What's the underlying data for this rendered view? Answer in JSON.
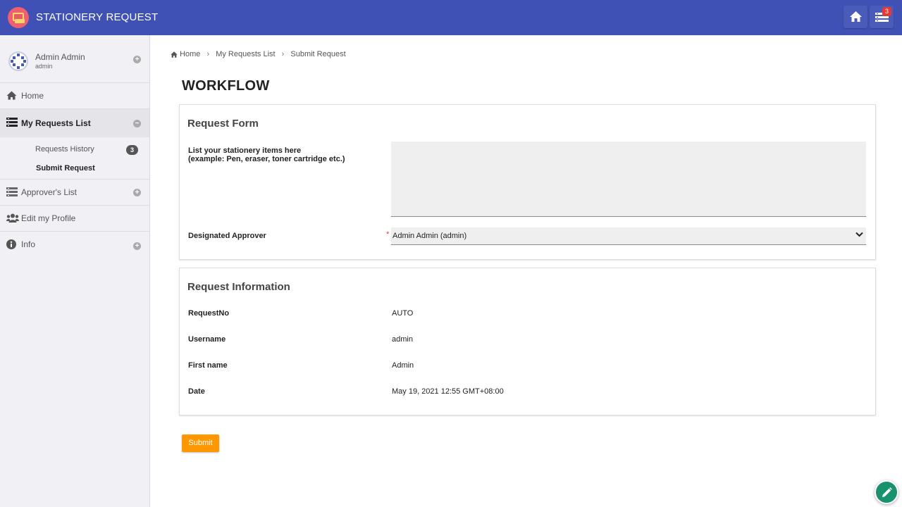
{
  "app": {
    "title": "STATIONERY REQUEST",
    "notification_count": "3"
  },
  "user": {
    "name": "Admin Admin",
    "login": "admin"
  },
  "sidebar": {
    "home": "Home",
    "my_requests": "My Requests List",
    "sub_items": [
      {
        "label": "Requests History",
        "badge": "3"
      },
      {
        "label": "Submit Request"
      }
    ],
    "approvers": "Approver's List",
    "profile": "Edit my Profile",
    "info": "Info"
  },
  "breadcrumb": [
    "Home",
    "My Requests List",
    "Submit Request"
  ],
  "page_title": "WORKFLOW",
  "request_form": {
    "heading": "Request Form",
    "items_label_line1": "List your stationery items here",
    "items_label_line2": "(example: Pen, eraser, toner cartridge etc.)",
    "items_value": "",
    "approver_label": "Designated Approver",
    "approver_required": "*",
    "approver_value": "Admin Admin (admin)"
  },
  "request_info": {
    "heading": "Request Information",
    "rows": [
      {
        "label": "RequestNo",
        "value": "AUTO"
      },
      {
        "label": "Username",
        "value": "admin"
      },
      {
        "label": "First name",
        "value": "Admin"
      },
      {
        "label": "Date",
        "value": "May 19, 2021 12:55 GMT+08:00"
      }
    ]
  },
  "submit_label": "Submit",
  "colors": {
    "topbar": "#3f51b5",
    "submit": "#ff9800",
    "fab": "#17916e"
  }
}
